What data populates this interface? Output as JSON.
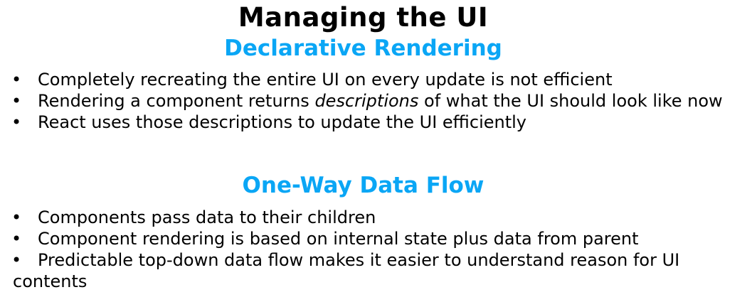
{
  "colors": {
    "accent": "#0AA6F5",
    "text": "#000000",
    "background": "#FFFFFF"
  },
  "title": "Managing the UI",
  "sections": [
    {
      "heading": "Declarative Rendering",
      "bullets": [
        {
          "text": "Completely recreating the entire UI on every update is not efficient"
        },
        {
          "pre": "Rendering a component returns ",
          "em": "descriptions",
          "post": " of what the UI should look like now"
        },
        {
          "text": "React uses those descriptions to update the UI efficiently"
        }
      ]
    },
    {
      "heading": "One-Way Data Flow",
      "bullets": [
        {
          "text": "Components pass data to their children"
        },
        {
          "text": "Component rendering is based on internal state plus data from parent"
        },
        {
          "text": "Predictable top-down data flow makes it easier to understand reason for UI contents"
        }
      ]
    }
  ]
}
